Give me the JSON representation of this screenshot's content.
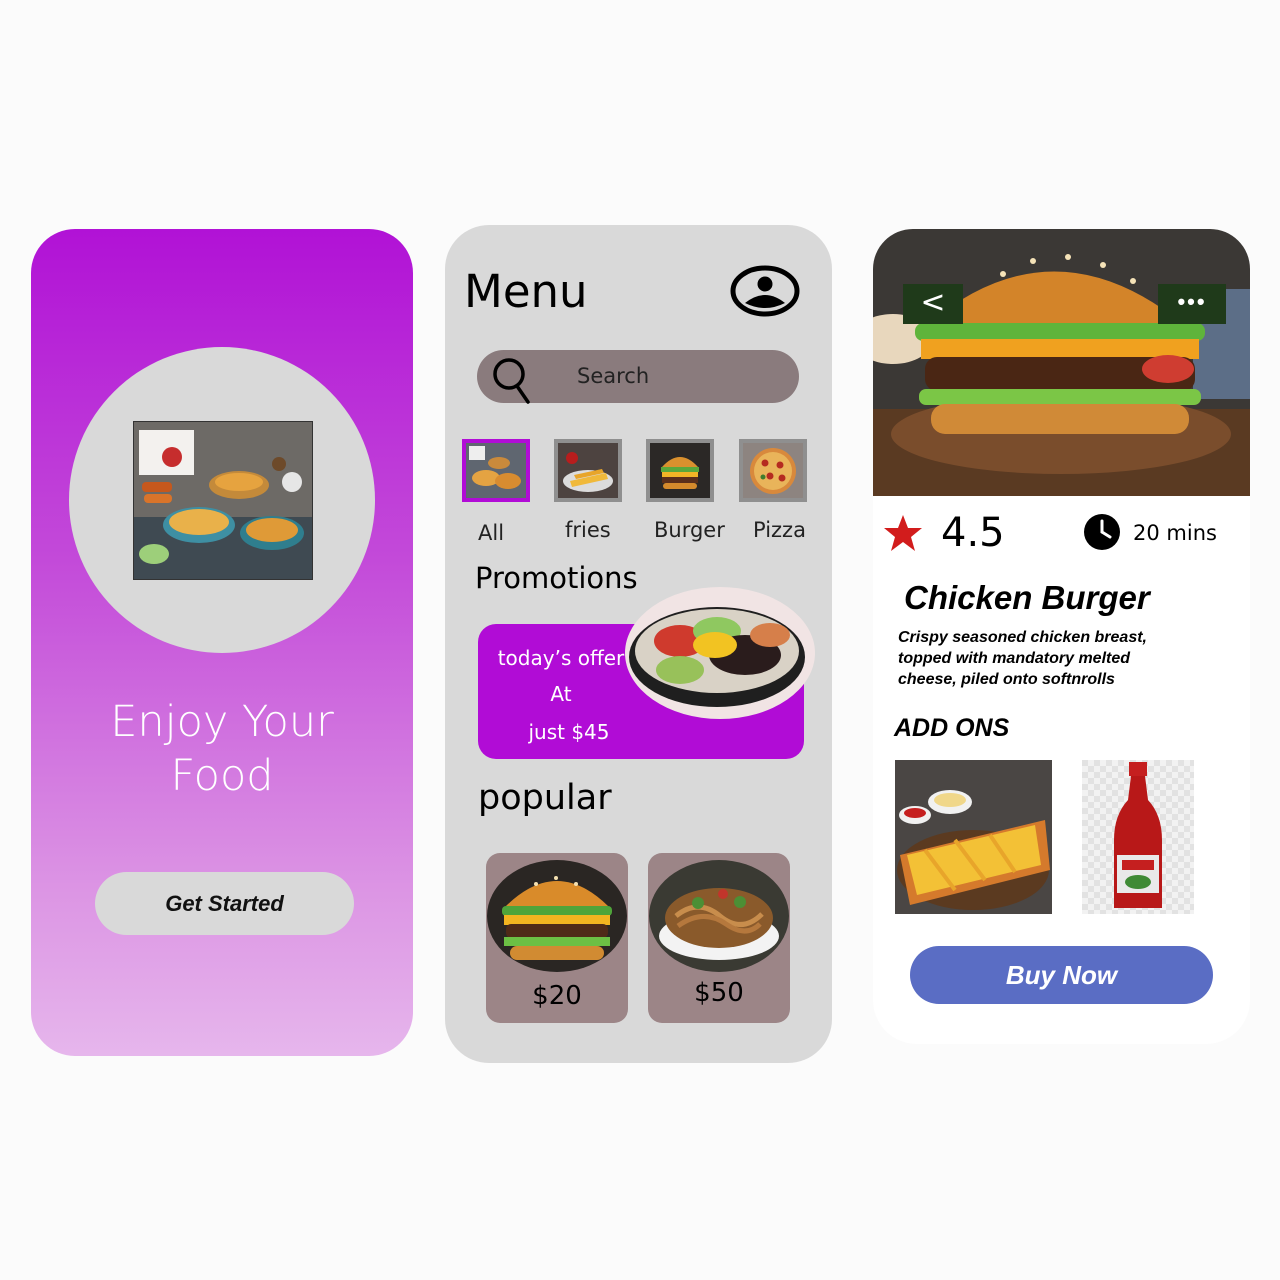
{
  "welcome": {
    "title_line1": "Enjoy Your",
    "title_line2": "Food",
    "cta_label": "Get Started",
    "hero_image": "food-spread-photo",
    "colors": {
      "gradient_top": "#b112d6",
      "gradient_bottom": "#e6b6ec",
      "circle": "#d9d9d9"
    }
  },
  "menu": {
    "title": "Menu",
    "profile_icon": "user-profile-icon",
    "search": {
      "placeholder": "Search",
      "icon": "search-icon"
    },
    "categories": [
      {
        "label": "All",
        "selected": true,
        "icon": "food-spread-thumb"
      },
      {
        "label": "fries",
        "selected": false,
        "icon": "fries-thumb"
      },
      {
        "label": "Burger",
        "selected": false,
        "icon": "burger-thumb"
      },
      {
        "label": "Pizza",
        "selected": false,
        "icon": "pizza-thumb"
      }
    ],
    "promotions_title": "Promotions",
    "promo": {
      "line1": "today’s offer",
      "line2": "At",
      "line3": "just $45"
    },
    "popular_title": "popular",
    "popular": [
      {
        "name": "burger",
        "price": "$20"
      },
      {
        "name": "noodles",
        "price": "$50"
      }
    ],
    "colors": {
      "background": "#d9d9d9",
      "accent": "#b10cd6",
      "search_bg": "#8a7b7d",
      "card_bg": "#9c8587"
    }
  },
  "detail": {
    "rating": "4.5",
    "time": "20 mins",
    "dish_name": "Chicken Burger",
    "description": [
      "Crispy seasoned chicken breast,",
      "topped with mandatory melted",
      "cheese, piled onto softnrolls"
    ],
    "addons_title": "ADD ONS",
    "addons": [
      {
        "name": "fries",
        "icon": "fries-addon-icon"
      },
      {
        "name": "ketchup",
        "icon": "ketchup-addon-icon"
      }
    ],
    "back_label": "<",
    "more_label": "•••",
    "buy_label": "Buy Now",
    "colors": {
      "star": "#d21c1c",
      "buy_button": "#5a6dc4",
      "nav_button": "#1f3a1a"
    }
  }
}
